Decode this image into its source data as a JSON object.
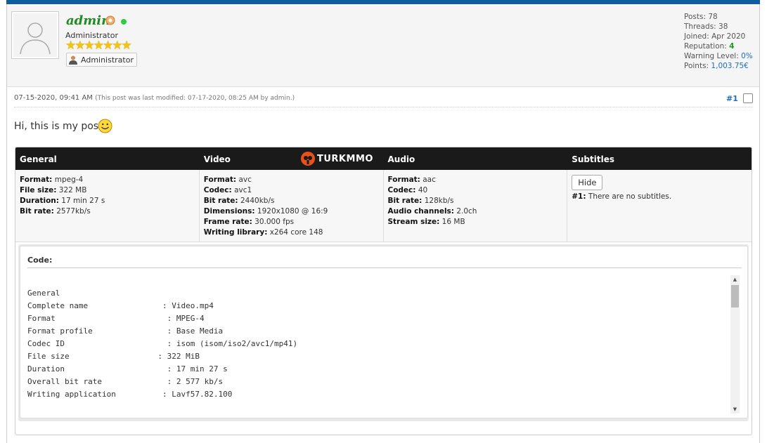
{
  "author": {
    "username": "admin",
    "user_title": "Administrator",
    "stars_count": 7,
    "group_label": "Administrator",
    "stats": {
      "posts": "Posts: 78",
      "threads": "Threads: 38",
      "joined": "Joined: Apr 2020",
      "reputation_label": "Reputation: ",
      "reputation_value": "4",
      "warning_label": "Warning Level: ",
      "warning_value": "0%",
      "points_label": "Points: ",
      "points_value": "1,003.75€"
    }
  },
  "post": {
    "date": "07-15-2020, 09:41 AM",
    "modified_prefix": "(This post was last modified: 07-17-2020, 08:25 AM by ",
    "modified_user": "admin",
    "modified_suffix": ".)",
    "number": "#1",
    "message": "Hi, this is my post."
  },
  "mediainfo": {
    "logo_text": "TURKMMO",
    "headers": [
      "General",
      "Video",
      "Audio",
      "Subtitles"
    ],
    "general": [
      {
        "k": "Format:",
        "v": " mpeg-4"
      },
      {
        "k": "File size:",
        "v": " 322 MB"
      },
      {
        "k": "Duration:",
        "v": " 17 min 27 s"
      },
      {
        "k": "Bit rate:",
        "v": " 2577kb/s"
      }
    ],
    "video": [
      {
        "k": "Format:",
        "v": " avc"
      },
      {
        "k": "Codec:",
        "v": " avc1"
      },
      {
        "k": "Bit rate:",
        "v": " 2440kb/s"
      },
      {
        "k": "Dimensions:",
        "v": " 1920x1080 @ 16:9"
      },
      {
        "k": "Frame rate:",
        "v": " 30.000 fps"
      },
      {
        "k": "Writing library:",
        "v": " x264 core 148"
      }
    ],
    "audio": [
      {
        "k": "Format:",
        "v": " aac"
      },
      {
        "k": "Codec:",
        "v": " 40"
      },
      {
        "k": "Bit rate:",
        "v": " 128kb/s"
      },
      {
        "k": "Audio channels:",
        "v": " 2.0ch"
      },
      {
        "k": "Stream size:",
        "v": " 16 MB"
      }
    ],
    "subtitles": {
      "hide_label": "Hide",
      "note_key": "#1:",
      "note_value": " There are no subtitles."
    }
  },
  "code": {
    "label": "Code:",
    "lines": [
      "General",
      "Complete name                : Video.mp4",
      "Format                        : MPEG-4",
      "Format profile                : Base Media",
      "Codec ID                      : isom (isom/iso2/avc1/mp41)",
      "File size                   : 322 MiB",
      "Duration                      : 17 min 27 s",
      "Overall bit rate              : 2 577 kb/s",
      "Writing application          : Lavf57.82.100"
    ]
  }
}
